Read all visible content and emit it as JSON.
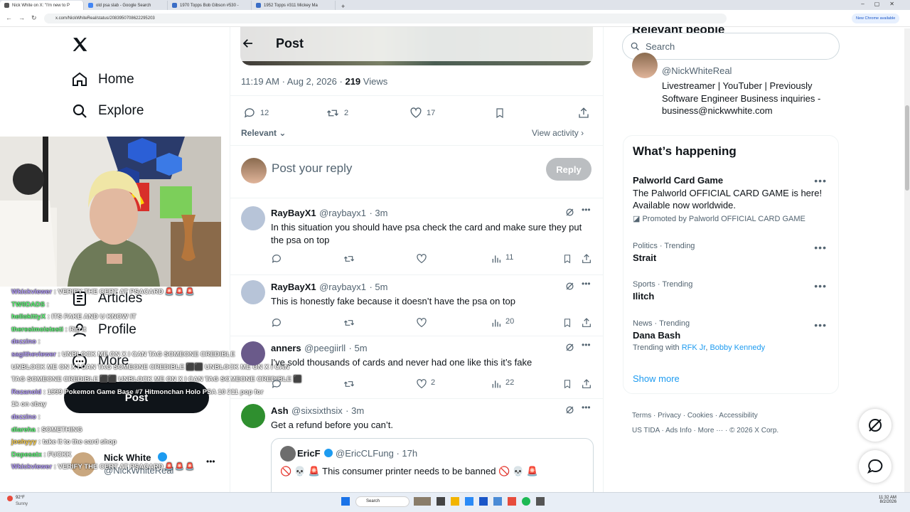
{
  "browser": {
    "tabs": [
      {
        "label": "Nick White on X: \"I'm new to P"
      },
      {
        "label": "old psa slab - Google Search"
      },
      {
        "label": "1970 Topps Bob Gibson #530 -"
      },
      {
        "label": "1952 Topps #311 Mickey Ma"
      }
    ],
    "url": "x.com/NickWhiteReal/status/2083950708622295203",
    "update_text": "New Chrome available"
  },
  "nav": {
    "items": [
      {
        "label": "Home"
      },
      {
        "label": "Explore"
      },
      {
        "label": "Articles"
      },
      {
        "label": "Profile"
      },
      {
        "label": "More"
      }
    ],
    "post_button": "Post",
    "account": {
      "name": "Nick White",
      "handle": "@NickWhiteReal",
      "more": "•••"
    }
  },
  "header": {
    "title": "Post"
  },
  "post": {
    "time": "11:19 AM · Aug 2, 2026 · ",
    "views_count": "219",
    "views_label": " Views",
    "replies": "12",
    "reposts": "2",
    "likes": "17",
    "sort_label": "Relevant",
    "view_activity": "View activity"
  },
  "composer": {
    "placeholder": "Post your reply",
    "button": "Reply"
  },
  "replies": [
    {
      "name": "RayBayX1",
      "handle": "@raybayx1",
      "time": "· 3m",
      "text": "In this situation you should have psa check the card and make sure they put the psa on top",
      "replies": "",
      "reposts": "",
      "likes": "",
      "views": "11"
    },
    {
      "name": "RayBayX1",
      "handle": "@raybayx1",
      "time": "· 5m",
      "text": "This is honestly fake because it doesn’t have the psa on top",
      "replies": "",
      "reposts": "",
      "likes": "",
      "views": "20"
    },
    {
      "name": "anners",
      "handle": "@peegiirll",
      "time": "· 5m",
      "text": "I've sold thousands of cards and never had one like this it’s fake",
      "replies": "",
      "reposts": "",
      "likes": "2",
      "views": "22"
    },
    {
      "name": "Ash",
      "handle": "@sixsixthsix",
      "time": "· 3m",
      "text": "Get a refund before you can’t."
    }
  ],
  "quote": {
    "name": "EricF",
    "handle": "@EricCLFung",
    "time": "· 17h",
    "text": "🚫 💀 🚨 This consumer printer needs to be banned 🚫 💀 🚨"
  },
  "right": {
    "search_placeholder": "Search",
    "relevant_heading": "Relevant people",
    "person": {
      "handle": "@NickWhiteReal",
      "bio": "Livestreamer | YouTuber | Previously Software Engineer Business inquiries - business@nickwwhite.com"
    },
    "happening_heading": "What’s happening",
    "promo": {
      "title": "Palworld Card Game",
      "text": "The Palworld OFFICIAL CARD GAME is here! Available now worldwide.",
      "promoted": "Promoted by Palworld OFFICIAL CARD GAME"
    },
    "trends": [
      {
        "meta": "Politics · Trending",
        "title": "Strait"
      },
      {
        "meta": "Sports · Trending",
        "title": "Ilitch"
      },
      {
        "meta": "News · Trending",
        "title": "Dana Bash",
        "with_label": "Trending with ",
        "with1": "RFK Jr",
        "with2": "Bobby Kennedy"
      }
    ],
    "show_more": "Show more",
    "footer": [
      "Terms",
      "Privacy",
      "Cookies",
      "Accessibility",
      "US TIDA",
      "Ads Info",
      "More ···",
      "© 2026 X Corp."
    ]
  },
  "chat": [
    {
      "user": "Wkickviewer",
      "msg": ": VERIFY THE CERT AT PSACARD 🚨 🚨 🚨"
    },
    {
      "user": "TW0DADS",
      "msg": ":"
    },
    {
      "user": "hellokittyX",
      "msg": ": ITS FAKE AND U KNOW IT"
    },
    {
      "user": "theresimoistesti",
      "msg": ": Rip it"
    },
    {
      "user": "dezzino",
      "msg": ":"
    },
    {
      "user": "sagitheviewer",
      "msg": ": UNBLOCK ME ON X I CAN TAG SOMEONE CREDIBLE"
    },
    {
      "user": "",
      "msg": "UNBLOCK ME ON X I CAN TAG SOMEONE CREDIBLE ⬛⬛ UNBLOCK ME ON X I CAN"
    },
    {
      "user": "",
      "msg": "TAG SOMEONE CREDIBLE ⬛⬛ UNBLOCK ME ON X I CAN TAG SOMEONE CREDIBLE ⬛"
    },
    {
      "user": "Rezanoid",
      "msg": ": 1999 Pokemon Game Base #7 Hitmonchan Holo PSA 10 211 pop for"
    },
    {
      "user": "",
      "msg": "1k on ebay"
    },
    {
      "user": "dezzino",
      "msg": ":"
    },
    {
      "user": "diareha",
      "msg": ": SOMETHING"
    },
    {
      "user": "joshyyy",
      "msg": ": take it to the card shop"
    },
    {
      "user": "Dopesatx",
      "msg": ": FUCKK"
    },
    {
      "user": "Wkickviewer",
      "msg": ": VERIFY THE CERT AT PSACARD 🚨 🚨 🚨"
    }
  ],
  "taskbar": {
    "search": "Search",
    "time": "11:32 AM",
    "date": "8/2/2026",
    "weather": "92°F",
    "weather_sub": "Sunny"
  }
}
